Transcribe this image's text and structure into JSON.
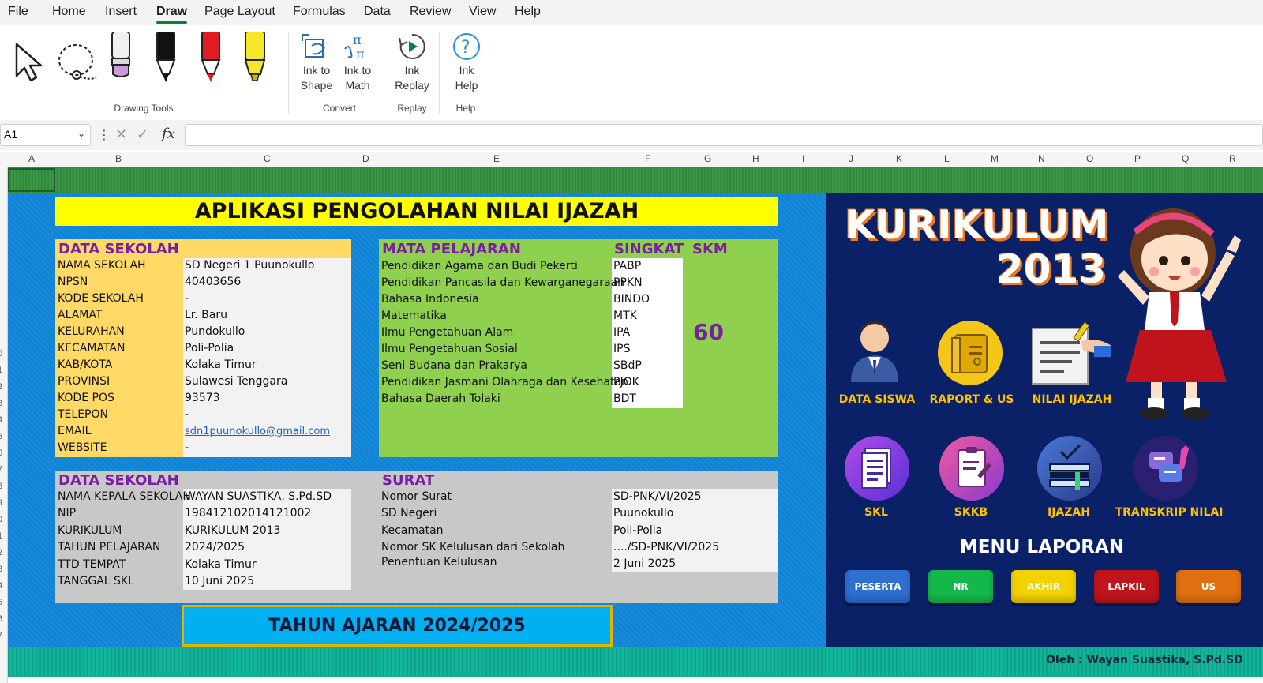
{
  "menubar": {
    "items": [
      "File",
      "Home",
      "Insert",
      "Draw",
      "Page Layout",
      "Formulas",
      "Data",
      "Review",
      "View",
      "Help"
    ],
    "active": "Draw"
  },
  "ribbon": {
    "groups": {
      "drawing_tools": "Drawing Tools",
      "convert": "Convert",
      "replay": "Replay",
      "help": "Help"
    },
    "buttons": {
      "ink_to_shape": [
        "Ink to",
        "Shape"
      ],
      "ink_to_math": [
        "Ink to",
        "Math"
      ],
      "ink_replay": [
        "Ink",
        "Replay"
      ],
      "ink_help": [
        "Ink",
        "Help"
      ]
    },
    "pen_colors": [
      "#cc99dd",
      "#111111",
      "#e01b24",
      "#f5e82a"
    ]
  },
  "formula_bar": {
    "name_box": "A1",
    "fx": "fx",
    "value": ""
  },
  "columns": [
    "A",
    "B",
    "C",
    "D",
    "E",
    "F",
    "G",
    "H",
    "I",
    "J",
    "K",
    "L",
    "M",
    "N",
    "O",
    "P",
    "Q",
    "R"
  ],
  "row_numbers": [
    "0",
    "1",
    "2",
    "3",
    "4",
    "5",
    "6",
    "7",
    "8",
    "9",
    "0",
    "1",
    "2",
    "3",
    "4",
    "5",
    "6",
    "7",
    "8",
    "9"
  ],
  "title": "APLIKASI PENGOLAHAN NILAI IJAZAH",
  "data_sekolah": {
    "header": "DATA SEKOLAH",
    "rows": [
      {
        "label": "NAMA SEKOLAH",
        "value": "SD Negeri 1 Puunokullo"
      },
      {
        "label": "NPSN",
        "value": "40403656"
      },
      {
        "label": "KODE SEKOLAH",
        "value": "-"
      },
      {
        "label": "ALAMAT",
        "value": "Lr. Baru"
      },
      {
        "label": "KELURAHAN",
        "value": "Pundokullo"
      },
      {
        "label": "KECAMATAN",
        "value": "Poli-Polia"
      },
      {
        "label": "KAB/KOTA",
        "value": "Kolaka Timur"
      },
      {
        "label": "PROVINSI",
        "value": "Sulawesi Tenggara"
      },
      {
        "label": "KODE POS",
        "value": "93573"
      },
      {
        "label": "TELEPON",
        "value": "-"
      },
      {
        "label": "EMAIL",
        "value": "sdn1puunokullo@gmail.com"
      },
      {
        "label": "WEBSITE",
        "value": "-"
      }
    ]
  },
  "mata_pelajaran": {
    "header": "MATA PELAJARAN",
    "singkat_header": "SINGKAT",
    "skm_header": "SKM",
    "skm_value": "60",
    "rows": [
      {
        "name": "Pendidikan Agama dan Budi Pekerti",
        "short": "PABP"
      },
      {
        "name": "Pendidikan Pancasila dan Kewarganegaraan",
        "short": "PPKN"
      },
      {
        "name": "Bahasa Indonesia",
        "short": "BINDO"
      },
      {
        "name": "Matematika",
        "short": "MTK"
      },
      {
        "name": "Ilmu Pengetahuan Alam",
        "short": "IPA"
      },
      {
        "name": "Ilmu Pengetahuan Sosial",
        "short": "IPS"
      },
      {
        "name": "Seni Budana dan Prakarya",
        "short": "SBdP"
      },
      {
        "name": "Pendidikan Jasmani Olahraga dan Kesehatan",
        "short": "PJOK"
      },
      {
        "name": "Bahasa Daerah Tolaki",
        "short": "BDT"
      }
    ]
  },
  "data_sekolah_2": {
    "header": "DATA SEKOLAH",
    "rows": [
      {
        "label": "NAMA KEPALA SEKOLAH",
        "value": "WAYAN SUASTIKA, S.Pd.SD"
      },
      {
        "label": "NIP",
        "value": "198412102014121002"
      },
      {
        "label": "KURIKULUM",
        "value": "KURIKULUM 2013"
      },
      {
        "label": "TAHUN PELAJARAN",
        "value": "2024/2025"
      },
      {
        "label": "TTD TEMPAT",
        "value": "Kolaka Timur"
      },
      {
        "label": "TANGGAL SKL",
        "value": "10 Juni 2025"
      }
    ]
  },
  "surat": {
    "header": "SURAT",
    "rows": [
      {
        "label": "Nomor Surat",
        "value": "SD-PNK/VI/2025"
      },
      {
        "label": "SD Negeri",
        "value": "Puunokullo"
      },
      {
        "label": "Kecamatan",
        "value": "Poli-Polia"
      },
      {
        "label": "Nomor SK Kelulusan dari Sekolah",
        "value": "..../SD-PNK/VI/2025"
      },
      {
        "label": "Penentuan Kelulusan",
        "value": "2 Juni 2025"
      }
    ]
  },
  "tahun_ajaran": "TAHUN AJARAN 2024/2025",
  "kurikulum": {
    "line1": "KURIKULUM",
    "line2": "2013"
  },
  "menu": {
    "items": [
      {
        "label": "DATA SISWA",
        "icon": "student-icon"
      },
      {
        "label": "RAPORT & US",
        "icon": "book-icon"
      },
      {
        "label": "NILAI IJAZAH",
        "icon": "certificate-icon"
      },
      {
        "label": "SKL",
        "icon": "document-icon"
      },
      {
        "label": "SKKB",
        "icon": "clipboard-icon"
      },
      {
        "label": "IJAZAH",
        "icon": "diploma-icon"
      },
      {
        "label": "TRANSKRIP NILAI",
        "icon": "chat-icon"
      }
    ]
  },
  "menu_laporan": {
    "title": "MENU LAPORAN",
    "buttons": [
      {
        "label": "PESERTA",
        "color": "#2f6fd0"
      },
      {
        "label": "NR",
        "color": "#14b84a"
      },
      {
        "label": "AKHIR",
        "color": "#f2d200"
      },
      {
        "label": "LAPKIL",
        "color": "#c0141c"
      },
      {
        "label": "US",
        "color": "#e0700f"
      }
    ]
  },
  "footer": "Oleh : Wayan Suastika, S.Pd.SD"
}
